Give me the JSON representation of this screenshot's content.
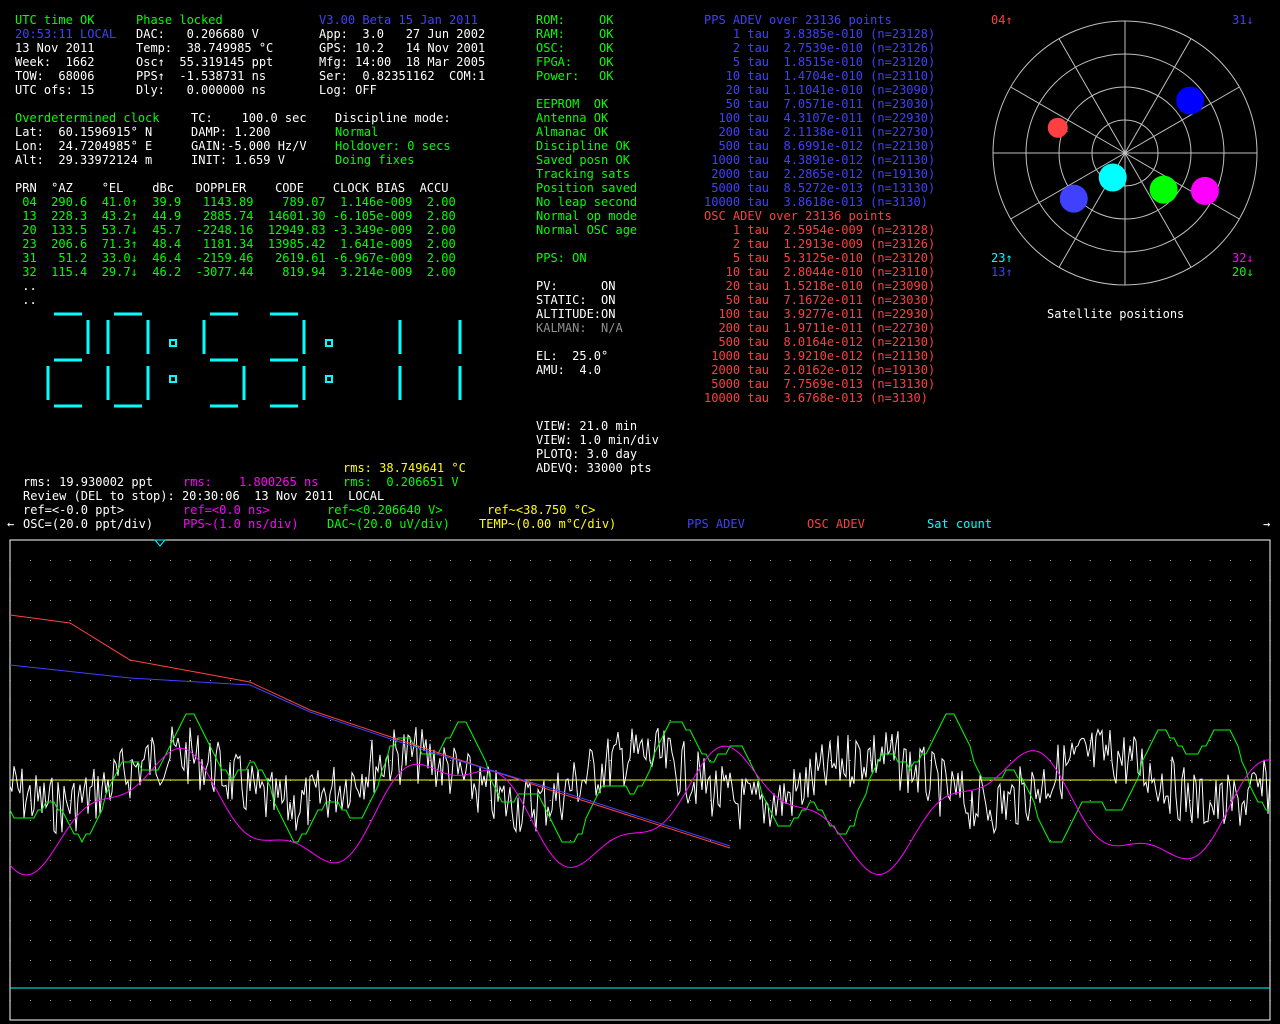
{
  "status": {
    "utc_status": "UTC time OK",
    "lock_status": "Phase locked",
    "local_time": "20:53:11 LOCAL",
    "date": "13 Nov 2011",
    "week": "Week:  1662",
    "tow": "TOW:  68006",
    "utc_ofs": "UTC ofs: 15",
    "dac": "DAC:   0.206680 V",
    "temp": "Temp:  38.749985 °C",
    "osc": "Osc↑  55.319145 ppt",
    "pps": "PPS↑  -1.538731 ns",
    "dly": "Dly:   0.000000 ns"
  },
  "version": {
    "title": "V3.00 Beta 15 Jan 2011",
    "app": "App:  3.0   27 Jun 2002",
    "gps": "GPS: 10.2   14 Nov 2001",
    "mfg": "Mfg: 14:00  18 Mar 2005",
    "ser": "Ser:  0.82351162  COM:1",
    "log": "Log: OFF"
  },
  "health": [
    {
      "label": "ROM:",
      "val": "OK"
    },
    {
      "label": "RAM:",
      "val": "OK"
    },
    {
      "label": "OSC:",
      "val": "OK"
    },
    {
      "label": "FPGA:",
      "val": "OK"
    },
    {
      "label": "Power:",
      "val": "OK"
    }
  ],
  "health2": [
    "EEPROM  OK",
    "Antenna OK",
    "Almanac OK",
    "Discipline OK",
    "Saved posn OK",
    "Tracking sats",
    "Position saved",
    "No leap second",
    "Normal op mode",
    "Normal OSC age"
  ],
  "pps_on": "PPS: ON",
  "flags": {
    "pv": "PV:      ON",
    "static": "STATIC:  ON",
    "altitude": "ALTITUDE:ON",
    "kalman": "KALMAN:  N/A"
  },
  "el": "EL:  25.0°",
  "amu": "AMU:  4.0",
  "view": {
    "v1": "VIEW: 21.0 min",
    "v2": "VIEW: 1.0 min/div",
    "plotq": "PLOTQ: 3.0 day",
    "adevq": "ADEVQ: 33000 pts"
  },
  "position": {
    "mode": "Overdetermined clock",
    "lat": "Lat:  60.1596915° N",
    "lon": "Lon:  24.7204985° E",
    "alt": "Alt:  29.33972124 m"
  },
  "discipline": {
    "tc": "TC:    100.0 sec",
    "damp": "DAMP: 1.200",
    "gain": "GAIN:-5.000 Hz/V",
    "init": "INIT: 1.659 V",
    "mode_label": "Discipline mode:",
    "mode": "Normal",
    "holdover": "Holdover: 0 secs",
    "fixes": "Doing fixes"
  },
  "sat_table": {
    "header": "PRN  °AZ    °EL    dBc   DOPPLER    CODE    CLOCK BIAS  ACCU",
    "rows": [
      " 04  290.6  41.0↑  39.9   1143.89    789.07  1.146e-009  2.00",
      " 13  228.3  43.2↑  44.9   2885.74  14601.30 -6.105e-009  2.80",
      " 20  133.5  53.7↓  45.7  -2248.16  12949.83 -3.349e-009  2.00",
      " 23  206.6  71.3↑  48.4   1181.34  13985.42  1.641e-009  2.00",
      " 31   51.2  33.0↓  46.4  -2159.46   2619.61 -6.967e-009  2.00",
      " 32  115.4  29.7↓  46.2  -3077.44    819.94  3.214e-009  2.00"
    ],
    "dots": [
      " ..",
      " .."
    ]
  },
  "clock": "20:53:11",
  "pps_adev": {
    "title": "PPS ADEV over 23136 points",
    "rows": [
      "    1 tau  3.8385e-010 (n=23128)",
      "    2 tau  2.7539e-010 (n=23126)",
      "    5 tau  1.8515e-010 (n=23120)",
      "   10 tau  1.4704e-010 (n=23110)",
      "   20 tau  1.1041e-010 (n=23090)",
      "   50 tau  7.0571e-011 (n=23030)",
      "  100 tau  4.3107e-011 (n=22930)",
      "  200 tau  2.1138e-011 (n=22730)",
      "  500 tau  8.6991e-012 (n=22130)",
      " 1000 tau  4.3891e-012 (n=21130)",
      " 2000 tau  2.2865e-012 (n=19130)",
      " 5000 tau  8.5272e-013 (n=13130)",
      "10000 tau  3.8618e-013 (n=3130)"
    ]
  },
  "osc_adev": {
    "title": "OSC ADEV over 23136 points",
    "rows": [
      "    1 tau  2.5954e-009 (n=23128)",
      "    2 tau  1.2913e-009 (n=23126)",
      "    5 tau  5.3125e-010 (n=23120)",
      "   10 tau  2.8044e-010 (n=23110)",
      "   20 tau  1.5218e-010 (n=23090)",
      "   50 tau  7.1672e-011 (n=23030)",
      "  100 tau  3.9277e-011 (n=22930)",
      "  200 tau  1.9711e-011 (n=22730)",
      "  500 tau  8.0164e-012 (n=22130)",
      " 1000 tau  3.9210e-012 (n=21130)",
      " 2000 tau  2.0162e-012 (n=19130)",
      " 5000 tau  7.7569e-013 (n=13130)",
      "10000 tau  3.6768e-013 (n=3130)"
    ]
  },
  "sky": {
    "caption": "Satellite positions",
    "corner_tl": "04↑",
    "corner_tr": "31↓",
    "corner_bl1": "23↑",
    "corner_bl2": "13↑",
    "corner_br1": "32↓",
    "corner_br2": "20↓",
    "sats": [
      {
        "prn": "04",
        "az": 290.6,
        "el": 41.0,
        "color": "#ff4040"
      },
      {
        "prn": "13",
        "az": 228.3,
        "el": 43.2,
        "color": "#4040ff"
      },
      {
        "prn": "20",
        "az": 133.5,
        "el": 53.7,
        "color": "#00ff00"
      },
      {
        "prn": "23",
        "az": 206.6,
        "el": 71.3,
        "color": "#00ffff"
      },
      {
        "prn": "31",
        "az": 51.2,
        "el": 33.0,
        "color": "#0000ff"
      },
      {
        "prn": "32",
        "az": 115.4,
        "el": 29.7,
        "color": "#ff00ff"
      }
    ]
  },
  "rms": {
    "temp": "rms: 38.749641 °C",
    "ppt": "rms: 19.930002 ppt",
    "ns_label": "rms:",
    "ns_val": "1.800265 ns",
    "v": "rms:  0.206651 V"
  },
  "review": "Review (DEL to stop): 20:30:06  13 Nov 2011  LOCAL",
  "legend": {
    "ref_ppt": "ref=<-0.0 ppt>",
    "ref_ns": "ref=<0.0 ns>",
    "ref_v": "ref~<0.206640 V>",
    "ref_c": "ref~<38.750 °C>",
    "arrow_left": "←",
    "arrow_right": "→",
    "osc": "OSC=(20.0 ppt/div)",
    "pps": "PPS~(1.0 ns/div)",
    "dac": "DAC~(20.0 uV/div)",
    "temp": "TEMP~(0.00 m°C/div)",
    "pps_adev": "PPS ADEV",
    "osc_adev": "OSC ADEV",
    "sat_count": "Sat count"
  },
  "colors": {
    "green": "#00ff00",
    "white": "#ffffff",
    "blue": "#4040ff",
    "red": "#ff4040",
    "yellow": "#ffff00",
    "magenta": "#ff00ff",
    "cyan": "#00ffff"
  }
}
